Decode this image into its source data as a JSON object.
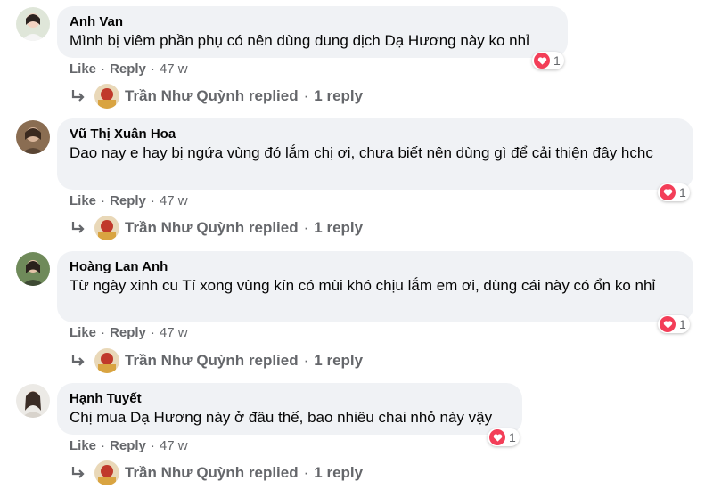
{
  "comments": [
    {
      "author": "Anh Van",
      "text": "Mình bị viêm phần phụ có nên dùng dung dịch Dạ Hương này ko nhỉ",
      "reaction_count": "1",
      "like": "Like",
      "reply": "Reply",
      "time": "47 w",
      "replier": "Trần Như Quỳnh replied",
      "reply_count": "1 reply"
    },
    {
      "author": "Vũ Thị Xuân Hoa",
      "text": "Dao nay e hay bị ngứa vùng đó lắm chị ơi, chưa biết nên dùng gì để cải thiện đây hchc",
      "reaction_count": "1",
      "like": "Like",
      "reply": "Reply",
      "time": "47 w",
      "replier": "Trần Như Quỳnh replied",
      "reply_count": "1 reply"
    },
    {
      "author": "Hoàng Lan Anh",
      "text": "Từ ngày xinh cu Tí xong vùng kín có mùi khó chịu lắm em ơi, dùng cái này có ổn ko nhỉ",
      "reaction_count": "1",
      "like": "Like",
      "reply": "Reply",
      "time": "47 w",
      "replier": "Trần Như Quỳnh replied",
      "reply_count": "1 reply"
    },
    {
      "author": "Hạnh Tuyết",
      "text": "Chị mua Dạ Hương này ở đâu thế, bao nhiêu chai nhỏ này vậy",
      "reaction_count": "1",
      "like": "Like",
      "reply": "Reply",
      "time": "47 w",
      "replier": "Trần Như Quỳnh replied",
      "reply_count": "1 reply"
    }
  ],
  "separator": "·",
  "colors": {
    "bubble": "#f0f2f5",
    "muted": "#65676b",
    "heart": "#f33e58"
  },
  "icons": {
    "reaction": "heart-reaction-icon",
    "reply": "reply-arrow-icon"
  }
}
